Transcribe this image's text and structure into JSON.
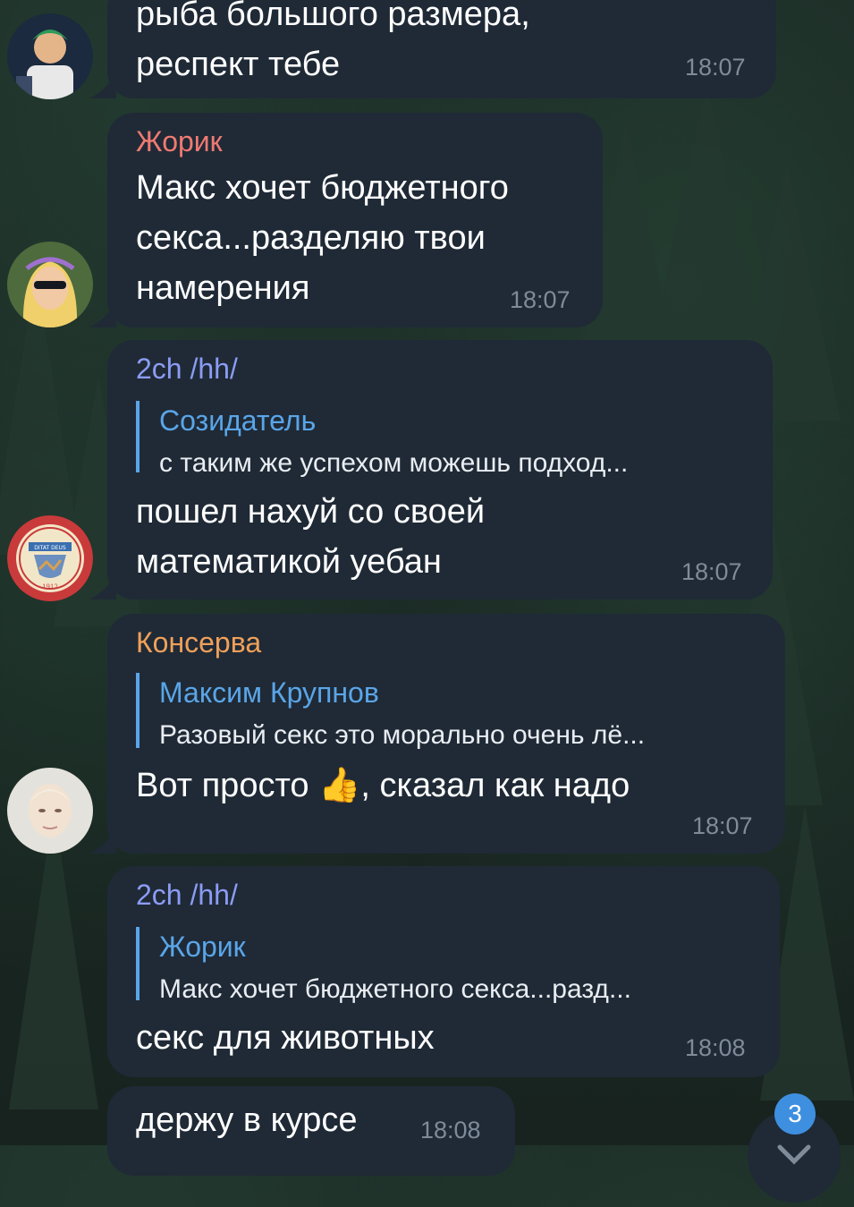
{
  "colors": {
    "bubble_bg": "#1f2a36",
    "time": "#7f8b99",
    "reply_accent": "#5aa5e8",
    "badge": "#3e8fe0"
  },
  "messages": [
    {
      "text": "рыба большого размера,\nреспект тебе",
      "time": "18:07",
      "avatar_icon": "cartoon-character-avatar"
    },
    {
      "sender": "Жорик",
      "sender_color": "#f07a72",
      "text": "Макс хочет бюджетного\nсекса...разделяю твои\nнамерения",
      "time": "18:07",
      "avatar_icon": "anime-girl-sunglasses-avatar"
    },
    {
      "sender": "2ch /hh/",
      "sender_color": "#8b9cf4",
      "reply": {
        "name": "Созидатель",
        "text": "с таким же успехом можешь подход..."
      },
      "text": "пошел нахуй со своей\nматематикой уебан",
      "time": "18:07",
      "avatar_icon": "arizona-seal-avatar",
      "seal_text": [
        "DITAT DEUS",
        "1912"
      ]
    },
    {
      "sender": "Консерва",
      "sender_color": "#f0a05a",
      "reply": {
        "name": "Максим Крупнов",
        "text": "Разовый секс это морально очень лё..."
      },
      "text": "Вот просто 👍, сказал как надо",
      "time": "18:07",
      "avatar_icon": "person-photo-avatar"
    },
    {
      "sender": "2ch /hh/",
      "sender_color": "#8b9cf4",
      "reply": {
        "name": "Жорик",
        "text": "Макс хочет бюджетного секса...разд..."
      },
      "text": "секс для животных",
      "time": "18:08"
    },
    {
      "text": "держу в курсе",
      "time": "18:08"
    }
  ],
  "unread_badge": "3",
  "scroll_down_icon": "chevron-down-icon"
}
